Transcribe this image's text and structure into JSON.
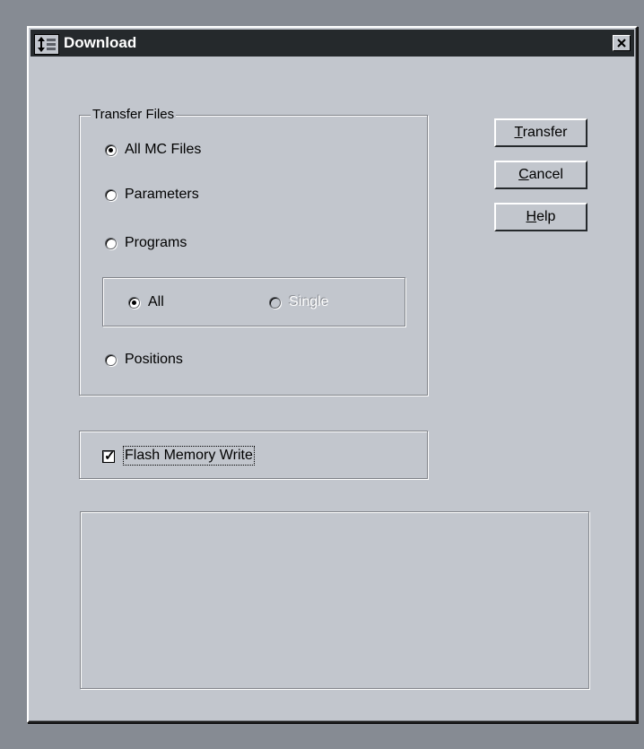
{
  "window": {
    "title": "Download",
    "close_glyph": "✕"
  },
  "transfer_files": {
    "label": "Transfer Files",
    "options": [
      {
        "label": "All MC Files",
        "checked": true
      },
      {
        "label": "Parameters",
        "checked": false
      },
      {
        "label": "Programs",
        "checked": false
      },
      {
        "label": "Positions",
        "checked": false
      }
    ],
    "programs_sub": [
      {
        "label": "All",
        "checked": true,
        "enabled": true
      },
      {
        "label": "Single",
        "checked": false,
        "enabled": false
      }
    ]
  },
  "flash": {
    "label": "Flash Memory Write",
    "checked": true,
    "check_glyph": "✓"
  },
  "buttons": {
    "transfer_u": "T",
    "transfer_rest": "ransfer",
    "cancel_u": "C",
    "cancel_rest": "ancel",
    "help_u": "H",
    "help_rest": "elp"
  },
  "icons": {
    "title": "up-down-arrows-icon"
  }
}
